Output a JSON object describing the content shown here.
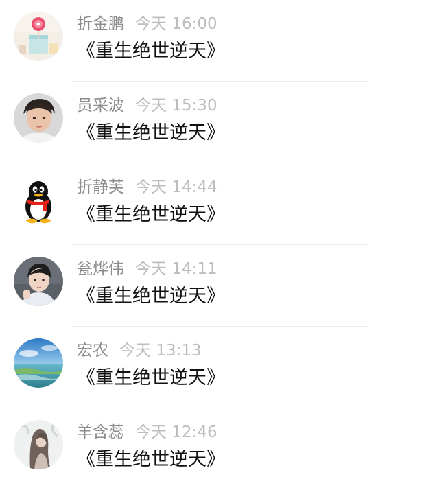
{
  "comments": [
    {
      "author": "折金鹏",
      "time": "今天 16:00",
      "content": "《重生绝世逆天》",
      "avatar_icon": "lollipop-jar-avatar"
    },
    {
      "author": "员采波",
      "time": "今天 15:30",
      "content": "《重生绝世逆天》",
      "avatar_icon": "boy-portrait-avatar"
    },
    {
      "author": "折静芙",
      "time": "今天 14:44",
      "content": "《重生绝世逆天》",
      "avatar_icon": "qq-penguin-avatar"
    },
    {
      "author": "瓮烨伟",
      "time": "今天 14:11",
      "content": "《重生绝世逆天》",
      "avatar_icon": "young-man-portrait-avatar"
    },
    {
      "author": "宏农",
      "time": "今天 13:13",
      "content": "《重生绝世逆天》",
      "avatar_icon": "seascape-island-avatar"
    },
    {
      "author": "羊含蕊",
      "time": "今天 12:46",
      "content": "《重生绝世逆天》",
      "avatar_icon": "long-hair-girl-avatar"
    }
  ],
  "colors": {
    "author": "#8d8d8d",
    "time": "#bdbdbd",
    "content": "#111111",
    "divider": "#ececec"
  }
}
